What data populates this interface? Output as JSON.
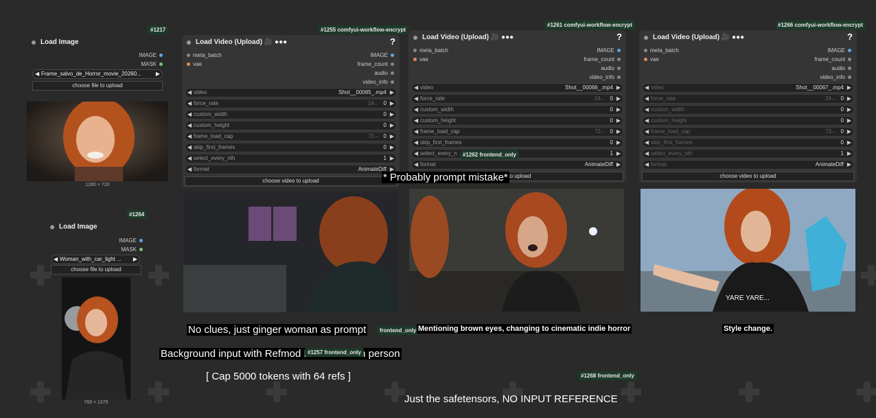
{
  "nodes": {
    "n1217": {
      "badge": "#1217",
      "title": "Load Image",
      "outputs": [
        "IMAGE",
        "MASK"
      ],
      "file": "Frame_salvo_de_Horror_movie_20260...",
      "upload": "choose file to upload",
      "dims": "1280 × 720"
    },
    "n1264": {
      "badge": "#1264",
      "title": "Load Image",
      "outputs": [
        "IMAGE",
        "MASK"
      ],
      "file": "Woman_with_car_light ...",
      "upload": "choose file to upload",
      "dims": "768 × 1376"
    },
    "n1255": {
      "badge": "#1255 comfyui-workflow-encrypt",
      "title": "Load Video (Upload) 🎥 ●●●",
      "help": "?",
      "inputs": [
        "meta_batch",
        "vae"
      ],
      "outputs": [
        "IMAGE",
        "frame_count",
        "audio",
        "video_info"
      ],
      "video": "Shot__00065_.mp4",
      "widgets": [
        {
          "label": "force_rate",
          "value": "0",
          "hint": "24←"
        },
        {
          "label": "custom_width",
          "value": "0"
        },
        {
          "label": "custom_height",
          "value": "0"
        },
        {
          "label": "frame_load_cap",
          "value": "0",
          "hint": "73←"
        },
        {
          "label": "skip_first_frames",
          "value": "0"
        },
        {
          "label": "select_every_nth",
          "value": "1"
        },
        {
          "label": "format",
          "value": "AnimateDiff"
        }
      ],
      "upload": "choose video to upload"
    },
    "n1261": {
      "badge": "#1261 comfyui-workflow-encrypt",
      "title": "Load Video (Upload) 🎥 ●●●",
      "help": "?",
      "inputs": [
        "meta_batch",
        "vae"
      ],
      "outputs": [
        "IMAGE",
        "frame_count",
        "audio",
        "video_info"
      ],
      "video": "Shot__00066_.mp4",
      "widgets": [
        {
          "label": "force_rate",
          "value": "0",
          "hint": "24←"
        },
        {
          "label": "custom_width",
          "value": "0"
        },
        {
          "label": "custom_height",
          "value": "0"
        },
        {
          "label": "frame_load_cap",
          "value": "0",
          "hint": "73←"
        },
        {
          "label": "skip_first_frames",
          "value": "0"
        },
        {
          "label": "select_every_n",
          "value": "1"
        },
        {
          "label": "format",
          "value": "AnimateDiff"
        }
      ],
      "upload": "o to upload"
    },
    "n1266": {
      "badge": "#1266 comfyui-workflow-encrypt",
      "title": "Load Video (Upload) 🎥 ●●●",
      "help": "?",
      "inputs": [
        "meta_batch",
        "vae"
      ],
      "outputs": [
        "IMAGE",
        "frame_count",
        "audio",
        "video_info"
      ],
      "video": "Shot__00067_.mp4",
      "widgets": [
        {
          "label": "force_rate",
          "value": "0",
          "hint": "24←"
        },
        {
          "label": "custom_width",
          "value": "0"
        },
        {
          "label": "custom_height",
          "value": "0"
        },
        {
          "label": "frame_load_cap",
          "value": "0",
          "hint": "73←"
        },
        {
          "label": "skip_first_frames",
          "value": "0"
        },
        {
          "label": "select_every_nth",
          "value": "1"
        },
        {
          "label": "format",
          "value": "AnimateDiff"
        }
      ],
      "upload": "choose video to upload"
    }
  },
  "floating_badges": {
    "b1262": "#1262 frontend_only",
    "b1257": "#1257 frontend_only",
    "b1268": "#1268 frontend_only",
    "bfront": "frontend_only"
  },
  "notes": {
    "probably": "* Probably prompt mistake*",
    "no_clues": "No clues, just ginger woman as prompt",
    "mentioning": "Mentioning brown eyes, changing to cinematic indie horror",
    "style": "Style change.",
    "background": "Background input with Refmod Reference on person",
    "cap": "[ Cap 5000 tokens with 64 refs ]",
    "safetensors": "Just the safetensors, NO INPUT REFERENCE",
    "yare": "YARE YARE..."
  },
  "colors": {
    "image_port": "#5aa7e6",
    "mask_port": "#7ec27e",
    "vae_port": "#e08a5a",
    "badge_bg": "#1d3a2a"
  }
}
